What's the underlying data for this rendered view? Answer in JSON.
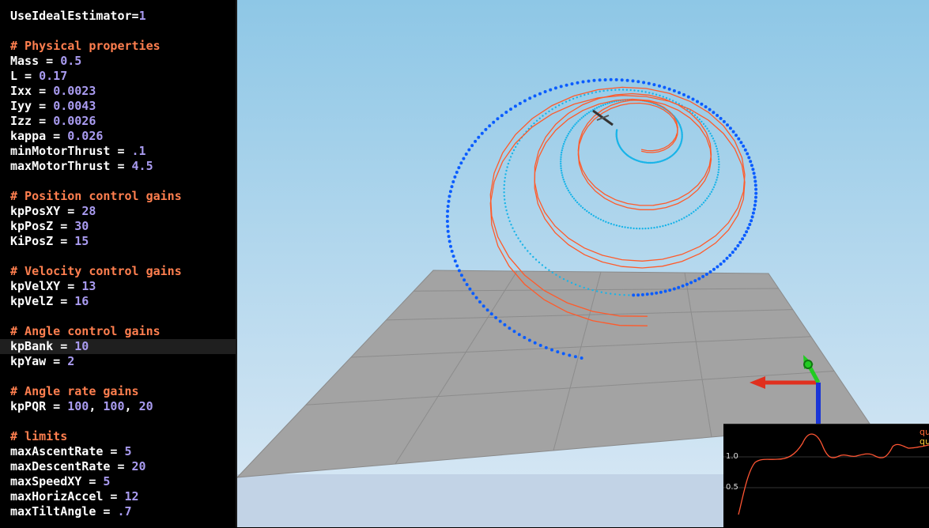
{
  "editor": {
    "lines": [
      {
        "type": "kv",
        "key": "UseIdealEstimator=",
        "value": "1"
      },
      {
        "type": "blank"
      },
      {
        "type": "comment",
        "text": "# Physical properties"
      },
      {
        "type": "kv",
        "key": "Mass = ",
        "value": "0.5"
      },
      {
        "type": "kv",
        "key": "L = ",
        "value": "0.17"
      },
      {
        "type": "kv",
        "key": "Ixx = ",
        "value": "0.0023"
      },
      {
        "type": "kv",
        "key": "Iyy = ",
        "value": "0.0043"
      },
      {
        "type": "kv",
        "key": "Izz = ",
        "value": "0.0026"
      },
      {
        "type": "kv",
        "key": "kappa = ",
        "value": "0.026"
      },
      {
        "type": "kv",
        "key": "minMotorThrust = ",
        "value": ".1"
      },
      {
        "type": "kv",
        "key": "maxMotorThrust = ",
        "value": "4.5"
      },
      {
        "type": "blank"
      },
      {
        "type": "comment",
        "text": "# Position control gains"
      },
      {
        "type": "kv",
        "key": "kpPosXY = ",
        "value": "28"
      },
      {
        "type": "kv",
        "key": "kpPosZ = ",
        "value": "30"
      },
      {
        "type": "kv",
        "key": "KiPosZ = ",
        "value": "15"
      },
      {
        "type": "blank"
      },
      {
        "type": "comment",
        "text": "# Velocity control gains"
      },
      {
        "type": "kv",
        "key": "kpVelXY = ",
        "value": "13"
      },
      {
        "type": "kv",
        "key": "kpVelZ = ",
        "value": "16"
      },
      {
        "type": "blank"
      },
      {
        "type": "comment",
        "text": "# Angle control gains"
      },
      {
        "type": "kv",
        "key": "kpBank = ",
        "value": "10",
        "highlight": true
      },
      {
        "type": "kv",
        "key": "kpYaw = ",
        "value": "2"
      },
      {
        "type": "blank"
      },
      {
        "type": "comment",
        "text": "# Angle rate gains"
      },
      {
        "type": "kvlist",
        "key": "kpPQR = ",
        "values": [
          "100",
          "100",
          "20"
        ]
      },
      {
        "type": "blank"
      },
      {
        "type": "comment",
        "text": "# limits"
      },
      {
        "type": "kv",
        "key": "maxAscentRate = ",
        "value": "5"
      },
      {
        "type": "kv",
        "key": "maxDescentRate = ",
        "value": "20"
      },
      {
        "type": "kv",
        "key": "maxSpeedXY = ",
        "value": "5"
      },
      {
        "type": "kv",
        "key": "maxHorizAccel = ",
        "value": "12"
      },
      {
        "type": "kv",
        "key": "maxTiltAngle = ",
        "value": ".7"
      }
    ]
  },
  "plot": {
    "ticks": [
      "1.0",
      "0.5"
    ],
    "legend": [
      {
        "text": "qu",
        "color": "#ff6633"
      },
      {
        "text": "qu",
        "color": "#ffcc33"
      }
    ],
    "line_color": "#ff5533"
  },
  "scene": {
    "sky_top": "#8ec7e6",
    "sky_bottom": "#dbe9f5",
    "trajectory_color": "#ff5a2a",
    "target_color": "#0a5cff"
  }
}
